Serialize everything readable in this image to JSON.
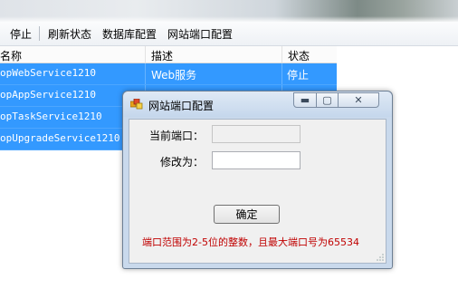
{
  "toolbar": {
    "items": [
      "停止",
      "刷新状态",
      "数据库配置",
      "网站端口配置"
    ]
  },
  "table": {
    "columns": [
      "名称",
      "描述",
      "状态"
    ],
    "rows": [
      {
        "name": "opWebService1210",
        "desc": "Web服务",
        "status": "停止"
      },
      {
        "name": "opAppService1210",
        "desc": "",
        "status": ""
      },
      {
        "name": "opTaskService1210",
        "desc": "",
        "status": ""
      },
      {
        "name": "opUpgradeService1210",
        "desc": "",
        "status": ""
      }
    ],
    "selected_color": "#3399ff"
  },
  "dialog": {
    "title": "网站端口配置",
    "current_port_label": "当前端口：",
    "current_port_value": "",
    "modify_label": "修改为：",
    "modify_value": "",
    "ok_label": "确定",
    "hint": "端口范围为2-5位的整数，且最大端口号为65534",
    "hint_color": "#c00000",
    "minimize_glyph": "▬",
    "maximize_glyph": "▢",
    "close_glyph": "✕"
  }
}
